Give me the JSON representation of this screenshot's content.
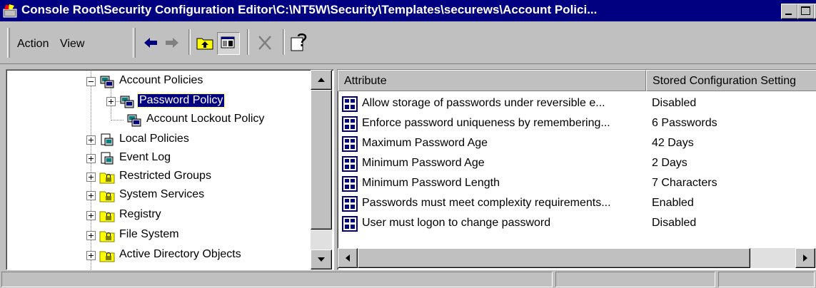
{
  "window": {
    "title": "Console Root\\Security Configuration Editor\\C:\\NT5W\\Security\\Templates\\securews\\Account Polici..."
  },
  "menu": {
    "action_label": "Action",
    "view_label": "View"
  },
  "tree": {
    "items": [
      {
        "label": "Account Policies",
        "expand": "minus",
        "icon": "policy-icon"
      },
      {
        "label": "Password Policy",
        "expand": "plus",
        "icon": "policy-icon",
        "selected": true
      },
      {
        "label": "Account Lockout Policy",
        "expand": "none",
        "icon": "policy-icon"
      },
      {
        "label": "Local Policies",
        "expand": "plus",
        "icon": "policy-icon"
      },
      {
        "label": "Event Log",
        "expand": "plus",
        "icon": "policy-icon"
      },
      {
        "label": "Restricted Groups",
        "expand": "plus",
        "icon": "locked-folder-icon"
      },
      {
        "label": "System Services",
        "expand": "plus",
        "icon": "locked-folder-icon"
      },
      {
        "label": "Registry",
        "expand": "plus",
        "icon": "locked-folder-icon"
      },
      {
        "label": "File System",
        "expand": "plus",
        "icon": "locked-folder-icon"
      },
      {
        "label": "Active Directory Objects",
        "expand": "plus",
        "icon": "locked-folder-icon"
      }
    ]
  },
  "list": {
    "columns": [
      "Attribute",
      "Stored Configuration Setting"
    ],
    "rows": [
      {
        "attribute": "Allow storage of passwords under reversible e...",
        "setting": "Disabled"
      },
      {
        "attribute": "Enforce password uniqueness by remembering...",
        "setting": "6 Passwords"
      },
      {
        "attribute": "Maximum Password Age",
        "setting": "42 Days"
      },
      {
        "attribute": "Minimum Password Age",
        "setting": "2 Days"
      },
      {
        "attribute": "Minimum Password Length",
        "setting": "7 Characters"
      },
      {
        "attribute": "Passwords must meet complexity requirements...",
        "setting": "Enabled"
      },
      {
        "attribute": "User must logon to change password",
        "setting": "Disabled"
      }
    ]
  },
  "colors": {
    "titlebar": "#000080",
    "selection": "#000080",
    "chrome": "#c0c0c0"
  }
}
